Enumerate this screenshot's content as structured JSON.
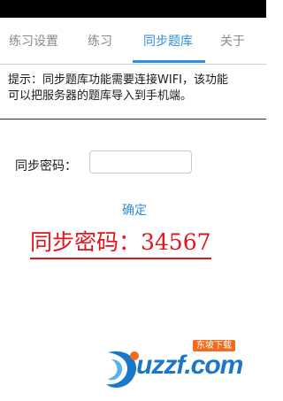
{
  "tabs": [
    {
      "label": "练习设置"
    },
    {
      "label": "练习"
    },
    {
      "label": "同步题库"
    },
    {
      "label": "关于"
    }
  ],
  "hint": {
    "line1": "提示：同步题库功能需要连接WIFI，该功能",
    "line2": "可以把服务器的题库导入到手机端。"
  },
  "form": {
    "password_label": "同步密码：",
    "password_value": "",
    "confirm_label": "确定"
  },
  "annotation": {
    "text": "同步密码：34567"
  },
  "watermark": {
    "text": "uzzf.com",
    "tag": "东坡下载"
  },
  "colors": {
    "accent": "#2f8fd8",
    "annotation": "#e4141b",
    "watermark_blue": "#1a77c9",
    "watermark_orange": "#f26a1b"
  }
}
